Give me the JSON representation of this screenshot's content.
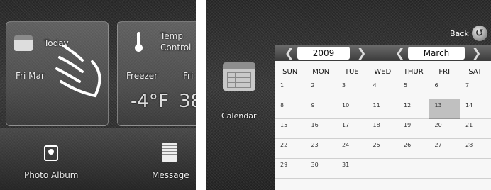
{
  "left_screen": {
    "today": {
      "label": "Today",
      "date": "Fri Mar"
    },
    "temp": {
      "label_line1": "Temp",
      "label_line2": "Control",
      "freezer_label": "Freezer",
      "fridge_label": "Fri",
      "freezer_value": "-4°F",
      "fridge_value": "38"
    },
    "bottom": {
      "photo_album_label": "Photo Album",
      "messages_label": "Message"
    },
    "icons": [
      "calendar-icon",
      "thermometer-icon",
      "photo-album-icon",
      "message-icon",
      "pointing-hand-icon"
    ]
  },
  "right_screen": {
    "side_label": "Calendar",
    "back_label": "Back",
    "year": "2009",
    "month": "March",
    "weekdays": [
      "SUN",
      "MON",
      "TUE",
      "WED",
      "THUR",
      "FRI",
      "SAT"
    ],
    "weeks": [
      [
        "1",
        "2",
        "3",
        "4",
        "5",
        "6",
        "7"
      ],
      [
        "8",
        "9",
        "10",
        "11",
        "12",
        "13",
        "14"
      ],
      [
        "15",
        "16",
        "17",
        "18",
        "19",
        "20",
        "21"
      ],
      [
        "22",
        "23",
        "24",
        "25",
        "26",
        "27",
        "28"
      ],
      [
        "29",
        "30",
        "31",
        "",
        "",
        "",
        ""
      ]
    ],
    "selected_day": "13",
    "icons": [
      "calendar-icon",
      "back-arrow-icon",
      "chevron-left-icon",
      "chevron-right-icon"
    ]
  }
}
